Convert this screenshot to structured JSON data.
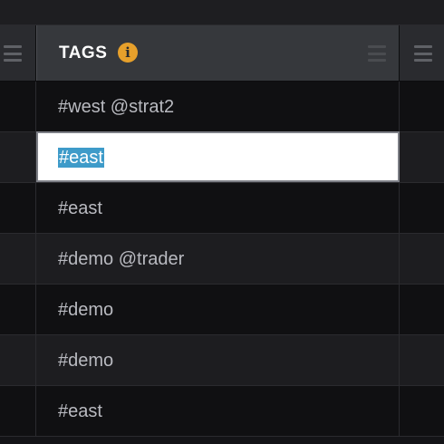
{
  "grid": {
    "column": {
      "title": "TAGS",
      "info_icon": "info-icon",
      "menu_icon": "hamburger-menu-icon"
    },
    "rows": [
      {
        "tag": "#west @strat2",
        "editing": false
      },
      {
        "tag": "#east",
        "editing": true,
        "selected_text": "#east"
      },
      {
        "tag": "#east",
        "editing": false
      },
      {
        "tag": "#demo @trader",
        "editing": false
      },
      {
        "tag": "#demo",
        "editing": false
      },
      {
        "tag": "#demo",
        "editing": false
      },
      {
        "tag": "#east",
        "editing": false
      }
    ]
  },
  "colors": {
    "header_bg": "#36383c",
    "info_accent": "#e7a02b",
    "selection": "#3e9bc9",
    "row_odd": "#101012",
    "row_even": "#1d1d20",
    "text": "#b9bac0"
  }
}
